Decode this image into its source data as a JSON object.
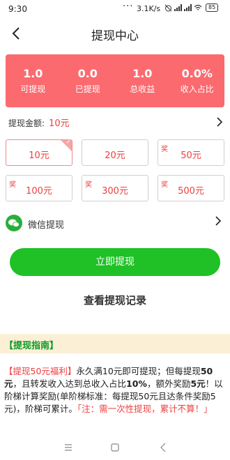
{
  "status_bar": {
    "time": "9:30",
    "dots": "···",
    "network_speed": "3.1K/s",
    "battery": "85"
  },
  "header": {
    "title": "提现中心"
  },
  "stats": [
    {
      "value": "1.0",
      "label": "可提现"
    },
    {
      "value": "0.0",
      "label": "已提现"
    },
    {
      "value": "1.0",
      "label": "总收益"
    },
    {
      "value": "0.0%",
      "label": "收入占比"
    }
  ],
  "amount": {
    "label": "提现金额:",
    "value": "10元"
  },
  "options": [
    {
      "amount": "10元",
      "badge": "",
      "selected": true
    },
    {
      "amount": "20元",
      "badge": "",
      "selected": false
    },
    {
      "amount": "50元",
      "badge": "奖",
      "selected": false
    },
    {
      "amount": "100元",
      "badge": "奖",
      "selected": false
    },
    {
      "amount": "300元",
      "badge": "奖",
      "selected": false
    },
    {
      "amount": "500元",
      "badge": "奖",
      "selected": false
    }
  ],
  "payment_method": {
    "label": "微信提现"
  },
  "withdraw_button": {
    "label": "立即提现"
  },
  "records_link": {
    "label": "查看提现记录"
  },
  "guide": {
    "title": "【提现指南】",
    "tag": "【提现50元福利】",
    "text_1": "永久满10元即可提现；但每提现",
    "bold_1": "50元",
    "text_2": "，且转发收入达到总收入占比",
    "bold_2": "10%",
    "text_3": "，额外奖励",
    "bold_3": "5元",
    "text_4": "！以阶梯计算奖励(单阶梯标准：每提现50元且达条件奖励5元)，阶梯可累计。",
    "note": "「注：需一次性提现，累计不算！」"
  },
  "colors": {
    "stats_bg": "#fb6a6f",
    "accent_red": "#ee3e3e",
    "button_green": "#1fc126",
    "guide_bg": "#fbefd6",
    "guide_title": "#0a9b23"
  }
}
